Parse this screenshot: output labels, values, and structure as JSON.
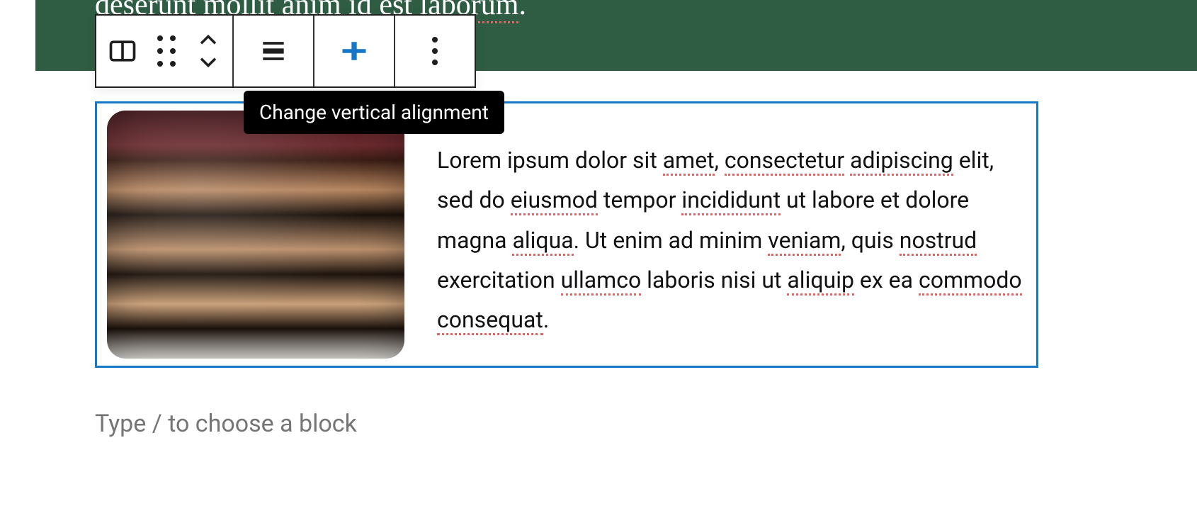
{
  "banner": {
    "text_plain": "deserunt mollit anim id est laborum.",
    "text_segments": [
      {
        "t": "deserunt",
        "sp": true
      },
      {
        "t": " "
      },
      {
        "t": "mollit",
        "sp": true
      },
      {
        "t": " anim id "
      },
      {
        "t": "est",
        "sp": true
      },
      {
        "t": " "
      },
      {
        "t": "laborum",
        "sp": true
      },
      {
        "t": "."
      }
    ]
  },
  "toolbar": {
    "tooltip": "Change vertical alignment"
  },
  "mediaText": {
    "image_alt": "Slice of layered chocolate cake",
    "paragraph_segments": [
      {
        "t": "Lorem ipsum dolor sit "
      },
      {
        "t": "amet",
        "sp": true
      },
      {
        "t": ", "
      },
      {
        "t": "consectetur",
        "sp": true
      },
      {
        "t": " "
      },
      {
        "t": "adipiscing",
        "sp": true
      },
      {
        "t": " elit, sed do "
      },
      {
        "t": "eiusmod",
        "sp": true
      },
      {
        "t": " tempor "
      },
      {
        "t": "incididunt",
        "sp": true
      },
      {
        "t": " ut labore et dolore magna "
      },
      {
        "t": "aliqua",
        "sp": true
      },
      {
        "t": ". Ut enim ad minim "
      },
      {
        "t": "veniam",
        "sp": true
      },
      {
        "t": ", quis "
      },
      {
        "t": "nostrud",
        "sp": true
      },
      {
        "t": " exercitation "
      },
      {
        "t": "ullamco",
        "sp": true
      },
      {
        "t": " laboris nisi ut "
      },
      {
        "t": "aliquip",
        "sp": true
      },
      {
        "t": " ex ea "
      },
      {
        "t": "commodo",
        "sp": true
      },
      {
        "t": " "
      },
      {
        "t": "consequat",
        "sp": true
      },
      {
        "t": "."
      }
    ]
  },
  "placeholder": {
    "text": "Type / to choose a block"
  }
}
